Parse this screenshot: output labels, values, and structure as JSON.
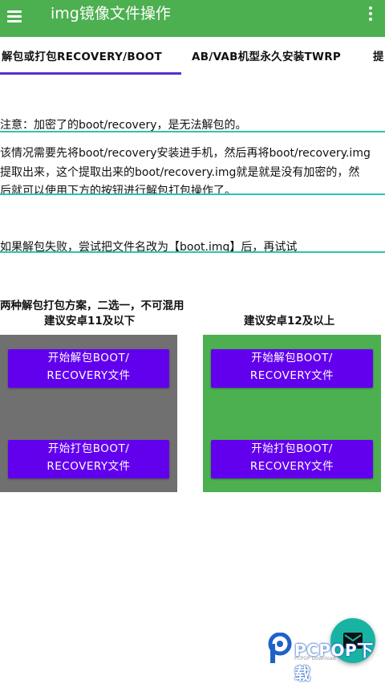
{
  "appbar": {
    "title": "img镜像文件操作",
    "menu_icon": "hamburger-menu-icon",
    "more_icon": "more-vertical-icon"
  },
  "tabs": [
    {
      "label": "解包或打包RECOVERY/BOOT",
      "selected": true
    },
    {
      "label": "AB/VAB机型永久安装TWRP",
      "selected": false
    },
    {
      "label": "提",
      "selected": false
    }
  ],
  "notes": {
    "encrypted": "注意：加密了的boot/recovery，是无法解包的。",
    "extract_line1": "该情况需要先将boot/recovery安装进手机，然后再将boot/recovery.img",
    "extract_line2": "提取出来，这个提取出来的boot/recovery.img就是就是没有加密的，然",
    "extract_line3": "后就可以使用下方的按钮进行解包打包操作了。",
    "rename": "如果解包失败，尝试把文件名改为【boot.img】后，再试试"
  },
  "schemes": {
    "title": "两种解包打包方案，二选一，不可混用",
    "left": {
      "label": "建议安卓11及以下",
      "unpack_line1": "开始解包BOOT/",
      "unpack_line2": "RECOVERY文件",
      "pack_line1": "开始打包BOOT/",
      "pack_line2": "RECOVERY文件"
    },
    "right": {
      "label": "建议安卓12及以上",
      "unpack_line1": "开始解包BOOT/",
      "unpack_line2": "RECOVERY文件",
      "pack_line1": "开始打包BOOT/",
      "pack_line2": "RECOVERY文件"
    }
  },
  "fab": {
    "icon": "email-icon"
  },
  "watermark": {
    "brand": "PCPOP下载",
    "sub": "PCPOP Download"
  },
  "colors": {
    "appbar": "#4caf50",
    "button": "#6200ee",
    "tab_indicator": "#5b2fd0",
    "underline": "#2ec4b0",
    "left_panel": "#707070",
    "right_panel": "#4caf50",
    "fab": "#19b3a3"
  }
}
